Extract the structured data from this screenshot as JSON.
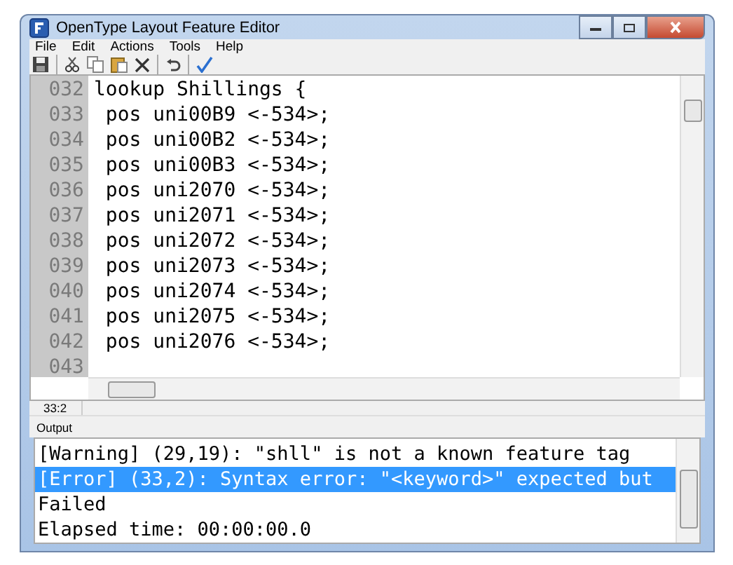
{
  "window": {
    "title": "OpenType Layout Feature Editor"
  },
  "menu": [
    "File",
    "Edit",
    "Actions",
    "Tools",
    "Help"
  ],
  "editor": {
    "lines": [
      {
        "number": "032",
        "text": "lookup Shillings {"
      },
      {
        "number": "033",
        "text": " pos uni00B9 <-534>;"
      },
      {
        "number": "034",
        "text": " pos uni00B2 <-534>;"
      },
      {
        "number": "035",
        "text": " pos uni00B3 <-534>;"
      },
      {
        "number": "036",
        "text": " pos uni2070 <-534>;"
      },
      {
        "number": "037",
        "text": " pos uni2071 <-534>;"
      },
      {
        "number": "038",
        "text": " pos uni2072 <-534>;"
      },
      {
        "number": "039",
        "text": " pos uni2073 <-534>;"
      },
      {
        "number": "040",
        "text": " pos uni2074 <-534>;"
      },
      {
        "number": "041",
        "text": " pos uni2075 <-534>;"
      },
      {
        "number": "042",
        "text": " pos uni2076 <-534>;"
      },
      {
        "number": "043"
      }
    ]
  },
  "status_bar": {
    "position": "33:2"
  },
  "output": {
    "label": "Output",
    "lines": [
      {
        "text": "[Warning] (29,19): \"shll\" is not a known feature tag",
        "selected": false
      },
      {
        "text": "[Error] (33,2): Syntax error: \"<keyword>\" expected but",
        "selected": true
      },
      {
        "text": "Failed",
        "selected": false
      },
      {
        "text": "Elapsed time: 00:00:00.0",
        "selected": false
      }
    ]
  }
}
